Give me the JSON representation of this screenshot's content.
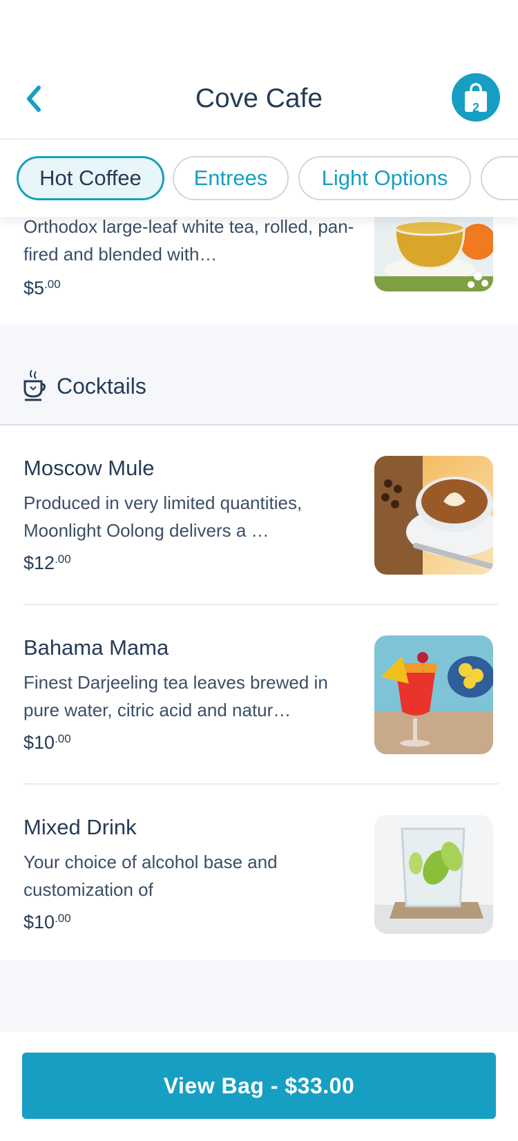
{
  "header": {
    "title": "Cove Cafe",
    "bag_count": "2"
  },
  "tabs": [
    {
      "label": "Hot Coffee",
      "active": true
    },
    {
      "label": "Entrees",
      "active": false
    },
    {
      "label": "Light Options",
      "active": false
    }
  ],
  "partial_item": {
    "desc": "Orthodox large-leaf white tea, rolled, pan-fired and blended with…",
    "price_main": "$5",
    "price_cents": ".00"
  },
  "section": {
    "title": "Cocktails",
    "icon": "teacup-icon"
  },
  "items": [
    {
      "name": "Moscow Mule",
      "desc": "Produced in very limited quantities, Moonlight Oolong delivers a …",
      "price_main": "$12",
      "price_cents": ".00",
      "image": "latte-photo"
    },
    {
      "name": "Bahama Mama",
      "desc": "Finest Darjeeling tea leaves brewed in pure water, citric acid and natur…",
      "price_main": "$10",
      "price_cents": ".00",
      "image": "tropical-cocktail-photo"
    },
    {
      "name": "Mixed Drink",
      "desc": "Your choice of alcohol base and customization of",
      "price_main": "$10",
      "price_cents": ".00",
      "image": "lime-drink-photo"
    }
  ],
  "footer": {
    "button_label": "View Bag - $33.00"
  },
  "colors": {
    "accent": "#169fc2",
    "text": "#253b56",
    "section_bg": "#f5f7fa"
  }
}
